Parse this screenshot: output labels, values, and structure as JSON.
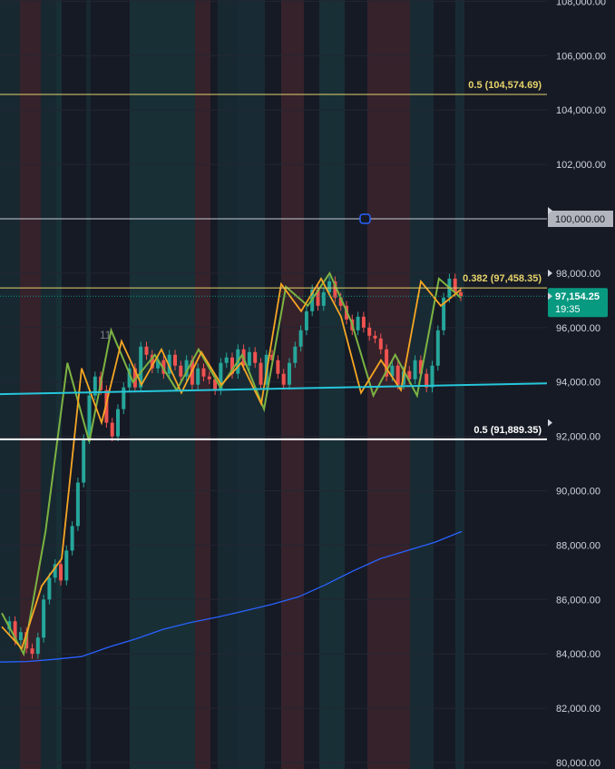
{
  "chart_data": {
    "type": "candlestick",
    "y_axis": {
      "ylim": [
        80000,
        108000
      ],
      "ticks": [
        "80,000.00",
        "82,000.00",
        "84,000.00",
        "86,000.00",
        "88,000.00",
        "90,000.00",
        "92,000.00",
        "94,000.00",
        "96,000.00",
        "98,000.00",
        "100,000.00",
        "102,000.00",
        "104,000.00",
        "106,000.00",
        "108,000.00"
      ],
      "tick_values": [
        80000,
        82000,
        84000,
        86000,
        88000,
        90000,
        92000,
        94000,
        96000,
        98000,
        100000,
        102000,
        104000,
        106000,
        108000
      ]
    },
    "current_price": {
      "label": "97,154.25",
      "countdown": "19:35",
      "value": 97154.25,
      "color": "#089981"
    },
    "marker_price": {
      "label": "100,000.00",
      "value": 100000
    },
    "fib_levels": [
      {
        "label": "0.5 (104,574.69)",
        "value": 104574.69,
        "color": "#e6d36b"
      },
      {
        "label": "0.382 (97,458.35)",
        "value": 97458.35,
        "color": "#e6d36b"
      },
      {
        "label": "0.5 (91,889.35)",
        "value": 91889.35,
        "color": "#ffffff"
      }
    ],
    "annotation": {
      "label": "11",
      "price": 96000
    },
    "trendline_cyan": {
      "from": 93550,
      "to": 93950,
      "color": "#26c6da"
    },
    "moving_average": {
      "color": "#2962ff",
      "values": [
        83700,
        83720,
        83800,
        83900,
        84250,
        84550,
        84900,
        85150,
        85350,
        85580,
        85820,
        86100,
        86550,
        87050,
        87500,
        87800,
        88100,
        88500
      ]
    },
    "zigzag_green": [
      85500,
      84000,
      88500,
      94700,
      91800,
      95900,
      94000,
      95000,
      93700,
      95200,
      93800,
      95000,
      93000,
      97500,
      96800,
      98000,
      96200,
      93500,
      95000,
      93500,
      97800,
      97100
    ],
    "zigzag_orange": [
      85000,
      84200,
      86500,
      87500,
      94500,
      92500,
      95500,
      93900,
      95200,
      93600,
      95100,
      93900,
      94700,
      93200,
      97600,
      96600,
      97800,
      96400,
      93600,
      94800,
      93700,
      97700,
      96800,
      97400
    ],
    "candles_close": [
      84900,
      85200,
      84500,
      84800,
      84200,
      84000,
      84600,
      86000,
      86800,
      87300,
      86700,
      87800,
      88700,
      90300,
      91900,
      93500,
      94200,
      93700,
      92500,
      92000,
      93000,
      93800,
      94500,
      93800,
      95300,
      95000,
      94500,
      94800,
      94300,
      95000,
      94600,
      94200,
      94800,
      93900,
      94500,
      94200,
      94100,
      93700,
      94700,
      94900,
      94300,
      95200,
      94600,
      95100,
      94700,
      93900,
      95000,
      94800,
      94300,
      93900,
      94700,
      95300,
      95900,
      96600,
      97400,
      96800,
      97300,
      97700,
      97100,
      96800,
      96300,
      95900,
      96400,
      96000,
      95700,
      95600,
      95200,
      94200,
      94600,
      93900,
      94400,
      94100,
      94800,
      94300,
      93800,
      94600,
      95900,
      97100,
      97800,
      97300,
      97154.25
    ],
    "background_bands": [
      {
        "from": 0,
        "to": 22,
        "color": "rgba(38,166,154,0.10)"
      },
      {
        "from": 22,
        "to": 45,
        "color": "rgba(239,83,80,0.15)"
      },
      {
        "from": 45,
        "to": 62,
        "color": "rgba(38,166,154,0.10)"
      },
      {
        "from": 62,
        "to": 68,
        "color": "rgba(38,166,154,0.15)"
      },
      {
        "from": 95,
        "to": 100,
        "color": "rgba(38,166,154,0.10)"
      },
      {
        "from": 143,
        "to": 215,
        "color": "rgba(38,166,154,0.15)"
      },
      {
        "from": 215,
        "to": 232,
        "color": "rgba(239,83,80,0.15)"
      },
      {
        "from": 240,
        "to": 262,
        "color": "rgba(38,166,154,0.10)"
      },
      {
        "from": 262,
        "to": 292,
        "color": "rgba(38,166,154,0.13)"
      },
      {
        "from": 310,
        "to": 335,
        "color": "rgba(239,83,80,0.15)"
      },
      {
        "from": 352,
        "to": 380,
        "color": "rgba(38,166,154,0.15)"
      },
      {
        "from": 405,
        "to": 452,
        "color": "rgba(239,83,80,0.15)"
      },
      {
        "from": 452,
        "to": 478,
        "color": "rgba(38,166,154,0.13)"
      },
      {
        "from": 502,
        "to": 512,
        "color": "rgba(38,166,154,0.13)"
      }
    ]
  }
}
